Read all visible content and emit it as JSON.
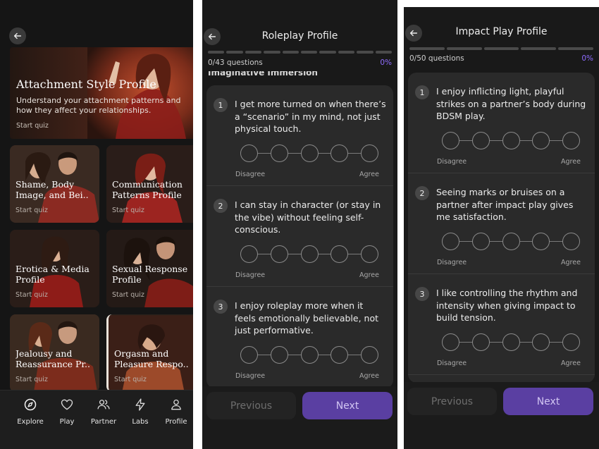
{
  "explore": {
    "hero": {
      "title": "Attachment Style Profile",
      "description": "Understand your attachment patterns and how they affect your relationships.",
      "cta": "Start quiz"
    },
    "cards": [
      {
        "title_line1": "Shame, Body",
        "title_line2": "Image, and Bei..",
        "cta": "Start quiz"
      },
      {
        "title_line1": "Communication",
        "title_line2": "Patterns Profile",
        "cta": "Start quiz"
      },
      {
        "title_line1": "Erotica & Media",
        "title_line2": "Profile",
        "cta": "Start quiz"
      },
      {
        "title_line1": "Sexual Response",
        "title_line2": "Profile",
        "cta": "Start quiz"
      },
      {
        "title_line1": "Jealousy and",
        "title_line2": "Reassurance Pr..",
        "cta": "Start quiz"
      },
      {
        "title_line1": "Orgasm and",
        "title_line2": "Pleasure Respo..",
        "cta": "Start quiz"
      }
    ],
    "tabs": [
      {
        "label": "Explore",
        "icon": "compass-icon"
      },
      {
        "label": "Play",
        "icon": "heart-icon"
      },
      {
        "label": "Partner",
        "icon": "users-icon"
      },
      {
        "label": "Labs",
        "icon": "lightning-icon"
      },
      {
        "label": "Profile",
        "icon": "user-icon"
      }
    ]
  },
  "roleplay": {
    "title": "Roleplay Profile",
    "count": "0/43 questions",
    "percent": "0%",
    "section_peek": "Imaginative Immersion",
    "questions": [
      {
        "num": "1",
        "text": "I get more turned on when there’s a “scenario” in my mind, not just physical touch."
      },
      {
        "num": "2",
        "text": "I can stay in character (or stay in the vibe) without feeling self-conscious."
      },
      {
        "num": "3",
        "text": "I enjoy roleplay more when it feels emotionally believable, not just performative."
      }
    ],
    "scale_left": "Disagree",
    "scale_right": "Agree",
    "prev_label": "Previous",
    "next_label": "Next"
  },
  "impact": {
    "title": "Impact Play Profile",
    "count": "0/50 questions",
    "percent": "0%",
    "questions": [
      {
        "num": "1",
        "text": "I enjoy inflicting light, playful strikes on a partner’s body during BDSM play."
      },
      {
        "num": "2",
        "text": "Seeing marks or bruises on a partner after impact play gives me satisfaction."
      },
      {
        "num": "3",
        "text": "I like controlling the rhythm and intensity when giving impact to build tension."
      }
    ],
    "scale_left": "Disagree",
    "scale_right": "Agree",
    "prev_label": "Previous",
    "next_label": "Next"
  },
  "colors": {
    "accent": "#8f6cff",
    "next_button": "#5a3fa2",
    "panel": "#2a2a2a",
    "background": "#191919"
  }
}
